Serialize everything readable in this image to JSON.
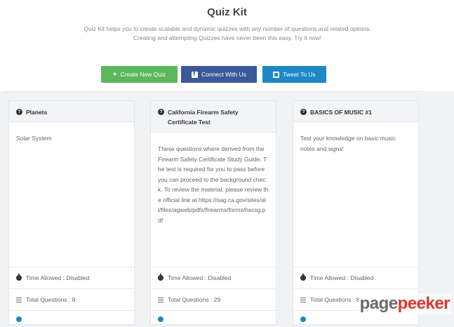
{
  "hero": {
    "title": "Quiz Kit",
    "description": "Quiz Kit helps you to create scalable and dynamic quizzes with any number of questions and related options. Creating and attempting Quizzes have never been this easy. Try it now!"
  },
  "buttons": {
    "create": "Create New Quiz",
    "connect": "Connect With Us",
    "tweet": "Tweet To Us"
  },
  "colors": {
    "create": "#5cb85c",
    "connect": "#3b5998",
    "tweet": "#1e88c7"
  },
  "quizzes": [
    {
      "title": "Planets",
      "description": "Solar System",
      "time_allowed": "Time Allowed : Disabled",
      "total_questions": "Total Questions : 8"
    },
    {
      "title": "California Firearm Safety Certificate Test",
      "description": "These questions where derived from the Firearm Safety Certificate Study Guide. The test is required for you to pass before you can proceed to the background check. To review the material, please review the official link at https://oag.ca.gov/sites/all/files/agweb/pdfs/firearms/forms/hscsg.pdf",
      "time_allowed": "Time Allowed : Disabled",
      "total_questions": "Total Questions : 29"
    },
    {
      "title": "BASICS OF MUSIC #1",
      "description": "Test your knowledge on basic music notes and signs!",
      "time_allowed": "Time Allowed : Disabled",
      "total_questions": "Total Questions : 8"
    }
  ],
  "icons": {
    "title": "question-circle-icon",
    "time": "stopwatch-icon",
    "count": "list-icon"
  },
  "watermark": {
    "part1": "page",
    "part2": "peeker"
  }
}
